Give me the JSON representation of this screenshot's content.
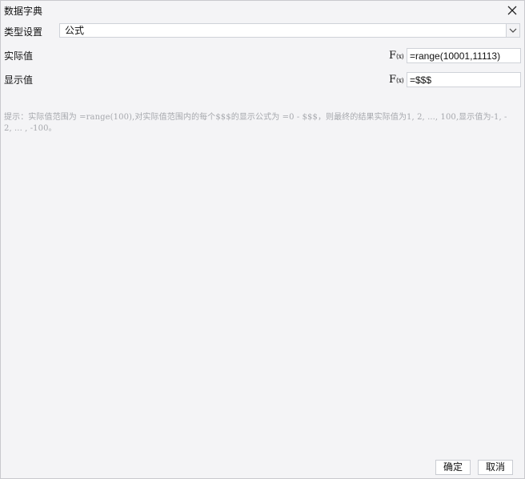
{
  "window": {
    "title": "数据字典"
  },
  "type_setting": {
    "label": "类型设置",
    "selected": "公式"
  },
  "actual_value": {
    "label": "实际值",
    "formula": "=range(10001,11113)"
  },
  "display_value": {
    "label": "显示值",
    "formula": "=$$$"
  },
  "hint": "提示：实际值范围为 =range(100),对实际值范围内的每个$$$的显示公式为 =0 - $$$，则最终的结果实际值为1, 2, ..., 100,显示值为-1, -2, ... , -100。",
  "buttons": {
    "ok": "确定",
    "cancel": "取消"
  },
  "icons": {
    "close": "close-icon",
    "dropdown": "chevron-down-icon",
    "formula": "fx-icon"
  }
}
